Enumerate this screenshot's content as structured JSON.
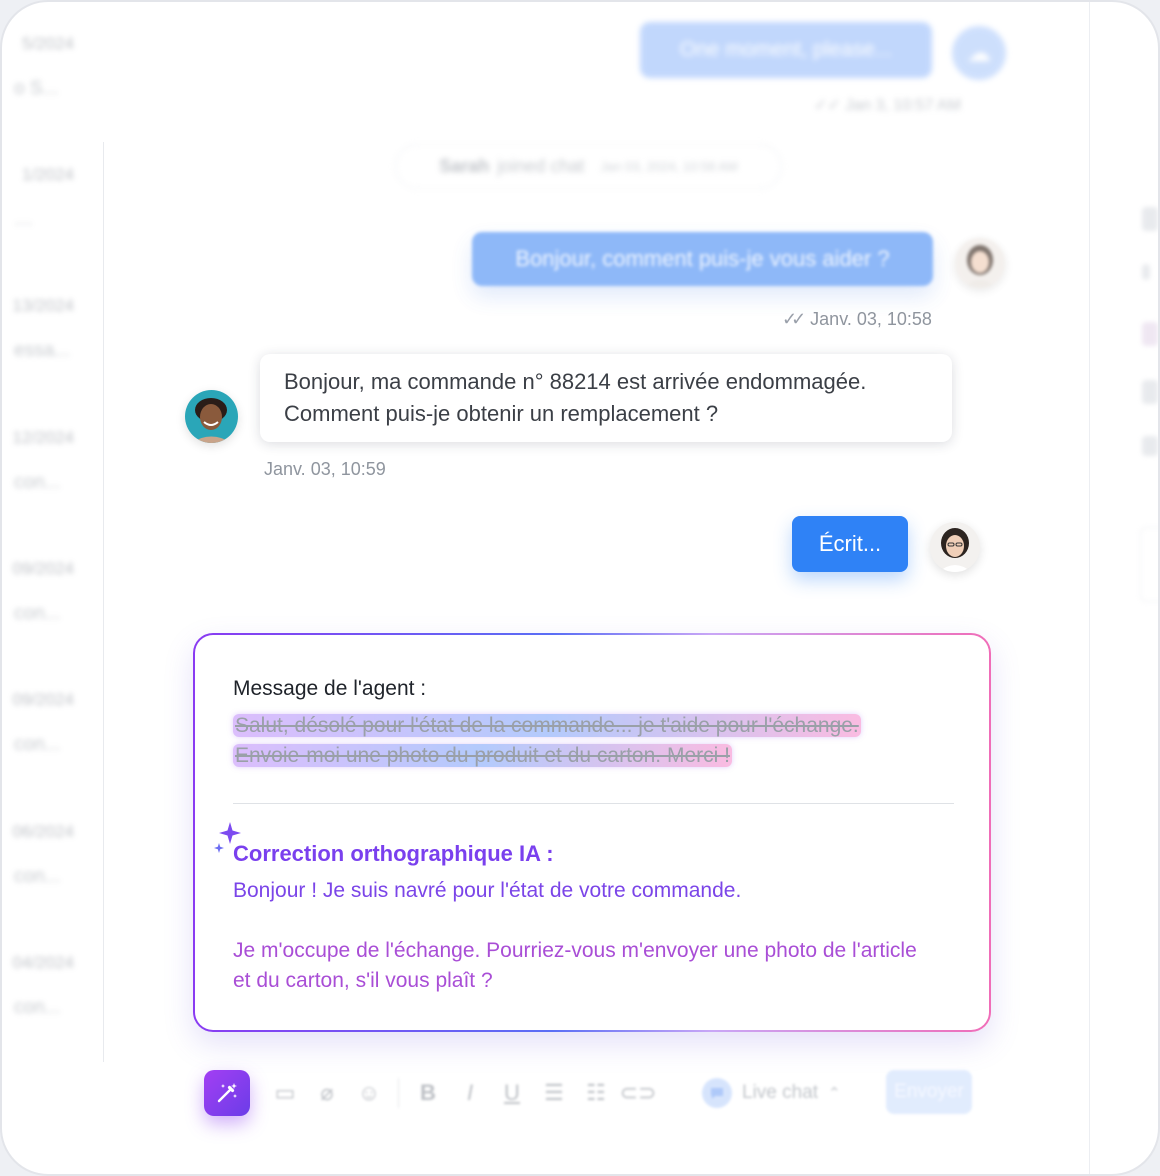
{
  "sidebar": {
    "conversations": [
      {
        "date": "5/2024",
        "preview": "o S..."
      },
      {
        "date": "1/2024",
        "preview": "…"
      },
      {
        "date": "13/2024",
        "preview": "essa..."
      },
      {
        "date": "12/2024",
        "preview": "con..."
      },
      {
        "date": "09/2024",
        "preview": "con..."
      },
      {
        "date": "09/2024",
        "preview": "con..."
      },
      {
        "date": "06/2024",
        "preview": "con..."
      },
      {
        "date": "04/2024",
        "preview": "con..."
      }
    ]
  },
  "chat": {
    "top_bubble": "One moment, please...",
    "top_meta": "Jan 3, 10:57 AM",
    "joined": {
      "name": "Sarah",
      "text": "joined chat",
      "time": "Jan 03, 2024, 10:58 AM"
    },
    "agent_message": "Bonjour, comment puis-je vous aider ?",
    "agent_meta": "Janv. 03, 10:58",
    "customer_message_line1": "Bonjour, ma commande n° 88214 est arrivée endommagée.",
    "customer_message_line2": "Comment puis-je obtenir un remplacement ?",
    "customer_meta": "Janv. 03, 10:59",
    "typing": "Écrit..."
  },
  "ai_card": {
    "label": "Message de l'agent :",
    "original_line1": "Salut, désolé pour l'état de la commande... je t'aide pour l'échange.",
    "original_line2": "Envoie-moi une photo du produit et du carton. Merci !",
    "correction_title": "Correction orthographique IA :",
    "correction_p1": "Bonjour ! Je suis navré pour l'état de votre commande.",
    "correction_p2": "Je m'occupe de l'échange. Pourriez-vous m'envoyer une photo de l'article et du carton, s'il vous plaît ?"
  },
  "toolbar": {
    "channel_label": "Live chat",
    "send_label": "Envoyer"
  },
  "colors": {
    "primary": "#2f82f6",
    "ai_purple": "#7a40ee",
    "ai_pink": "#f06db8"
  }
}
